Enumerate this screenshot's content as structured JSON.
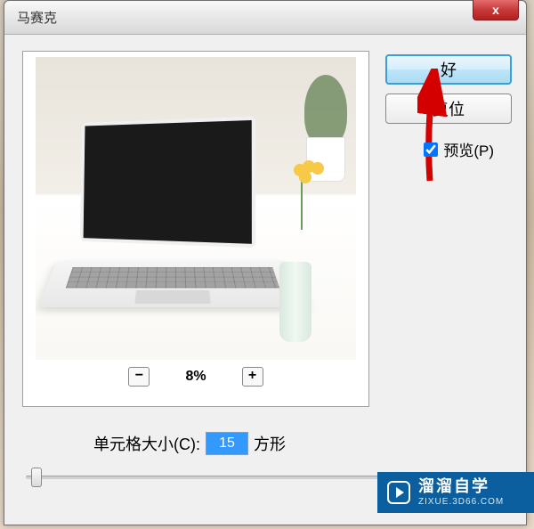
{
  "dialog": {
    "title": "马赛克",
    "close": "x"
  },
  "buttons": {
    "ok": "好",
    "reset": "复位"
  },
  "preview_checkbox": {
    "label": "预览(P)",
    "checked": true
  },
  "zoom": {
    "minus": "−",
    "plus": "+",
    "level": "8%"
  },
  "cellsize": {
    "label": "单元格大小(C):",
    "value": "15",
    "unit": "方形"
  },
  "watermark": {
    "main": "溜溜自学",
    "sub": "ZIXUE.3D66.COM"
  }
}
